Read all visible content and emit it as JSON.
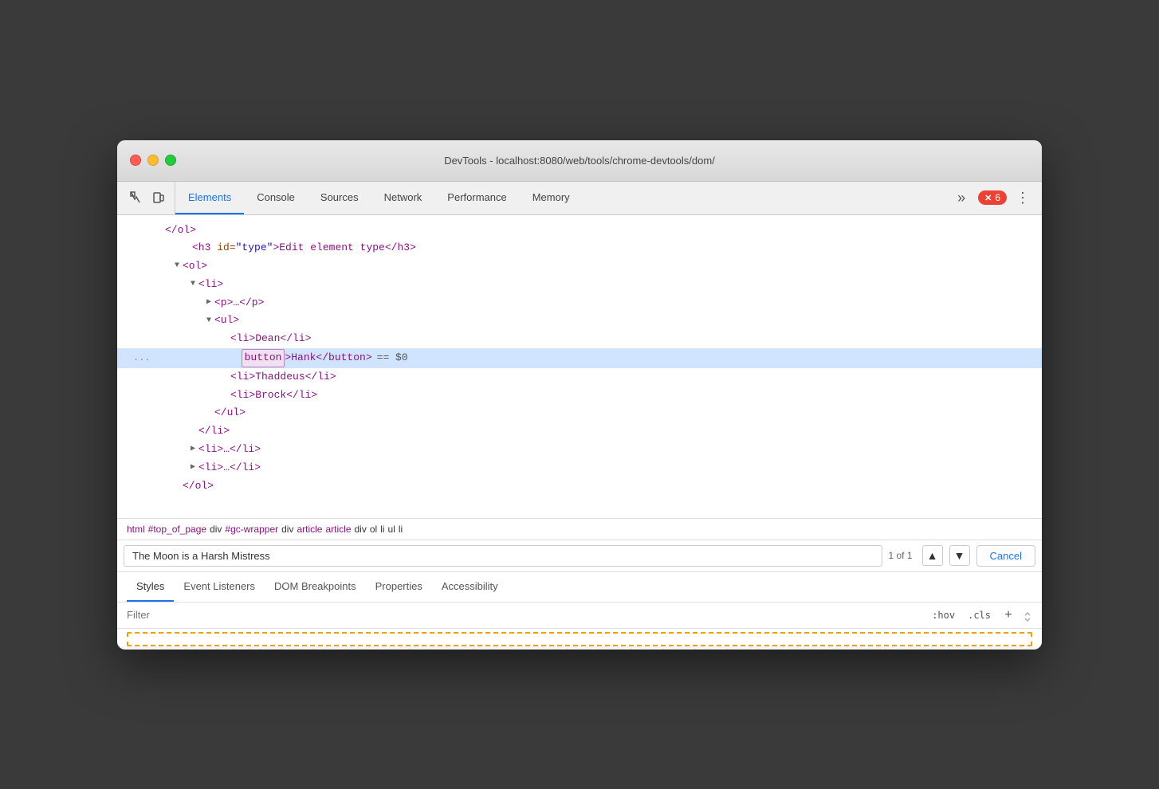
{
  "titlebar": {
    "title": "DevTools - localhost:8080/web/tools/chrome-devtools/dom/"
  },
  "tabs": {
    "items": [
      {
        "label": "Elements",
        "active": true
      },
      {
        "label": "Console",
        "active": false
      },
      {
        "label": "Sources",
        "active": false
      },
      {
        "label": "Network",
        "active": false
      },
      {
        "label": "Performance",
        "active": false
      },
      {
        "label": "Memory",
        "active": false
      }
    ],
    "more_label": "»",
    "error_count": "6",
    "menu_icon": "⋮"
  },
  "dom": {
    "lines": [
      {
        "indent": 0,
        "content": "</ol>",
        "type": "tag-only",
        "color": "purple"
      },
      {
        "indent": 1,
        "content_parts": [
          {
            "text": "<h3 ",
            "color": "purple"
          },
          {
            "text": "id=",
            "color": "attr"
          },
          {
            "text": "\"type\"",
            "color": "blue"
          },
          {
            "text": ">Edit element type</h3>",
            "color": "purple"
          }
        ]
      },
      {
        "indent": 1,
        "triangle": "open",
        "content_parts": [
          {
            "text": "<ol>",
            "color": "purple"
          }
        ]
      },
      {
        "indent": 2,
        "triangle": "open",
        "content_parts": [
          {
            "text": "<li>",
            "color": "purple"
          }
        ]
      },
      {
        "indent": 3,
        "triangle": "closed",
        "content_parts": [
          {
            "text": "<p>…</p>",
            "color": "purple"
          }
        ]
      },
      {
        "indent": 3,
        "triangle": "open",
        "content_parts": [
          {
            "text": "<ul>",
            "color": "purple"
          }
        ]
      },
      {
        "indent": 4,
        "content_parts": [
          {
            "text": "<li>Dean</li>",
            "color": "purple"
          }
        ]
      },
      {
        "indent": 4,
        "content_parts": [
          {
            "text": "<button",
            "color": "highlight"
          },
          {
            "text": ">Hank</button>",
            "color": "purple"
          },
          {
            "text": " == $0",
            "color": "dollar"
          }
        ],
        "selected": true,
        "dots": "..."
      },
      {
        "indent": 4,
        "content_parts": [
          {
            "text": "<li>Thaddeus</li>",
            "color": "purple"
          }
        ]
      },
      {
        "indent": 4,
        "content_parts": [
          {
            "text": "<li>Brock</li>",
            "color": "purple"
          }
        ]
      },
      {
        "indent": 3,
        "content_parts": [
          {
            "text": "</ul>",
            "color": "purple"
          }
        ]
      },
      {
        "indent": 2,
        "content_parts": [
          {
            "text": "</li>",
            "color": "purple"
          }
        ]
      },
      {
        "indent": 1,
        "triangle": "closed",
        "content_parts": [
          {
            "text": "<li>…</li>",
            "color": "purple"
          }
        ]
      },
      {
        "indent": 1,
        "triangle": "closed",
        "content_parts": [
          {
            "text": "<li>…</li>",
            "color": "purple"
          }
        ]
      },
      {
        "indent": 1,
        "content_parts": [
          {
            "text": "</ol>",
            "color": "purple"
          }
        ]
      }
    ]
  },
  "breadcrumb": {
    "items": [
      {
        "label": "html",
        "color": "purple"
      },
      {
        "label": "#top_of_page",
        "color": "purple"
      },
      {
        "label": "div",
        "color": "black"
      },
      {
        "label": "#gc-wrapper",
        "color": "purple"
      },
      {
        "label": "div",
        "color": "black"
      },
      {
        "label": "article",
        "color": "purple"
      },
      {
        "label": "article",
        "color": "purple"
      },
      {
        "label": "div",
        "color": "black"
      },
      {
        "label": "ol",
        "color": "black"
      },
      {
        "label": "li",
        "color": "black"
      },
      {
        "label": "ul",
        "color": "black"
      },
      {
        "label": "li",
        "color": "black"
      }
    ]
  },
  "search": {
    "value": "The Moon is a Harsh Mistress",
    "count": "1 of 1",
    "cancel_label": "Cancel",
    "up_arrow": "▲",
    "down_arrow": "▼"
  },
  "lower_panel": {
    "tabs": [
      {
        "label": "Styles",
        "active": true
      },
      {
        "label": "Event Listeners",
        "active": false
      },
      {
        "label": "DOM Breakpoints",
        "active": false
      },
      {
        "label": "Properties",
        "active": false
      },
      {
        "label": "Accessibility",
        "active": false
      }
    ],
    "filter": {
      "placeholder": "Filter",
      "hov_label": ":hov",
      "cls_label": ".cls",
      "new_rule": "+"
    }
  }
}
